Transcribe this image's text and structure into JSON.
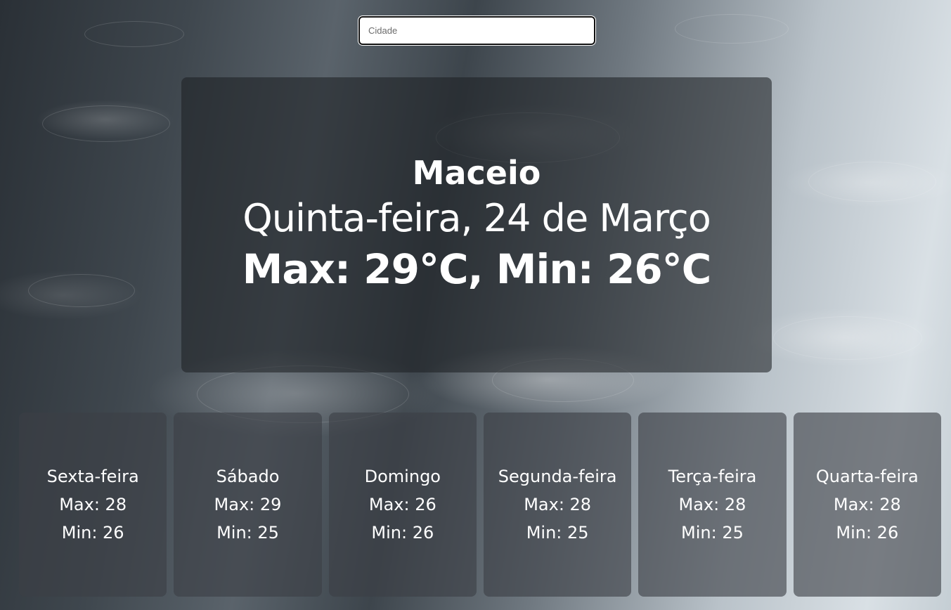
{
  "search": {
    "placeholder": "Cidade",
    "value": ""
  },
  "current": {
    "city": "Maceio",
    "date": "Quinta-feira, 24 de Março",
    "temps": "Max: 29°C, Min: 26°C"
  },
  "forecast": [
    {
      "day": "Sexta-feira",
      "max": "Max: 28",
      "min": "Min: 26"
    },
    {
      "day": "Sábado",
      "max": "Max: 29",
      "min": "Min: 25"
    },
    {
      "day": "Domingo",
      "max": "Max: 26",
      "min": "Min: 26"
    },
    {
      "day": "Segunda-feira",
      "max": "Max: 28",
      "min": "Min: 25"
    },
    {
      "day": "Terça-feira",
      "max": "Max: 28",
      "min": "Min: 25"
    },
    {
      "day": "Quarta-feira",
      "max": "Max: 28",
      "min": "Min: 26"
    }
  ],
  "colors": {
    "card_overlay": "#1e2024",
    "text": "#ffffff"
  }
}
